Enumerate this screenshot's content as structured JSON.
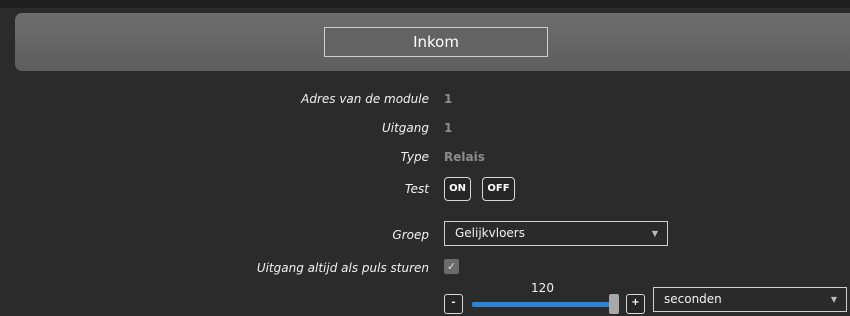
{
  "header": {
    "title": "Inkom"
  },
  "fields": {
    "module_address": {
      "label": "Adres van de module",
      "value": "1"
    },
    "output": {
      "label": "Uitgang",
      "value": "1"
    },
    "type": {
      "label": "Type",
      "value": "Relais"
    },
    "test": {
      "label": "Test",
      "on_label": "ON",
      "off_label": "OFF"
    },
    "group": {
      "label": "Groep",
      "selected": "Gelijkvloers"
    },
    "pulse": {
      "label": "Uitgang altijd als puls sturen",
      "checked": true,
      "check_glyph": "✓"
    },
    "duration": {
      "value": "120",
      "minus": "-",
      "plus": "+",
      "slider_fraction": 1.0,
      "unit_selected": "seconden"
    }
  },
  "icons": {
    "dropdown": "chevron-down-icon",
    "check": "check-icon"
  },
  "colors": {
    "header": "#666666",
    "background": "#2b2b2b",
    "slider_track": "#2d84d4"
  }
}
